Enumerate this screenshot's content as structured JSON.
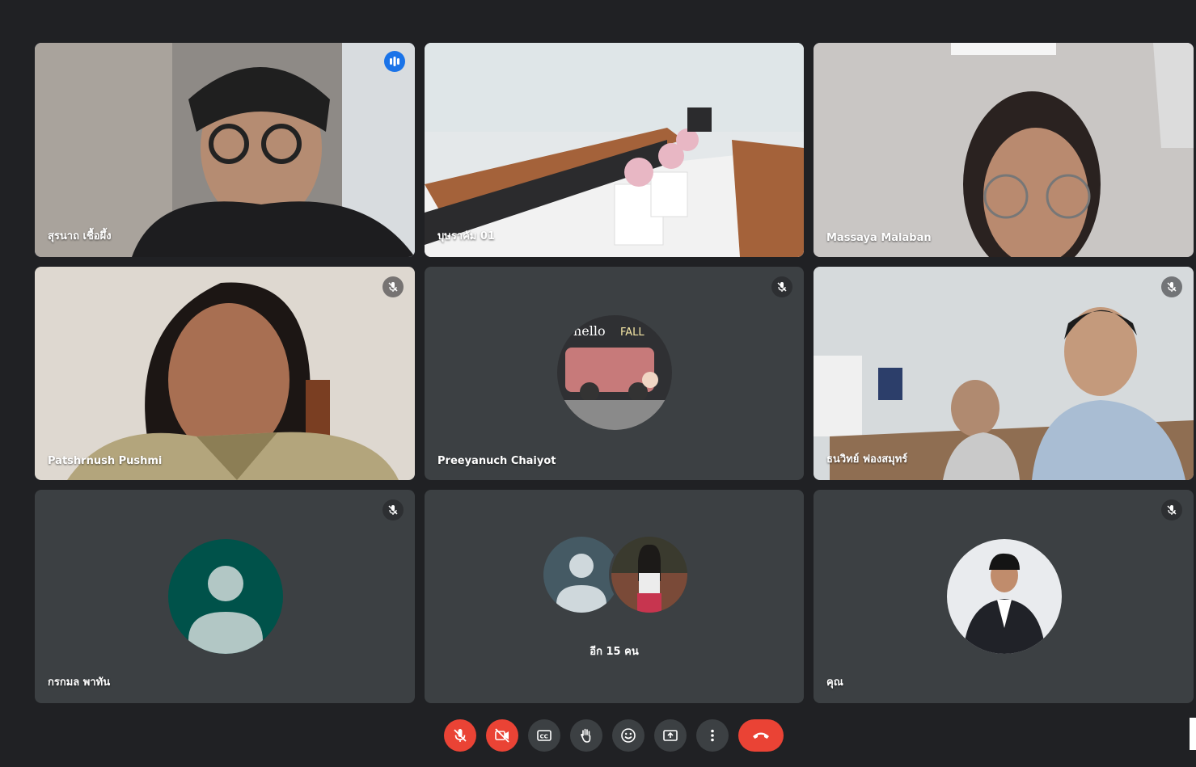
{
  "participants": [
    {
      "name": "สุรนาถ เชื้อผึ้ง"
    },
    {
      "name": "บุษราคัม 01"
    },
    {
      "name": "Massaya Malaban"
    },
    {
      "name": "Patshrnush Pushmi"
    },
    {
      "name": "Preeyanuch Chaiyot"
    },
    {
      "name": "ธนวิทย์ ฟองสมุทร์"
    },
    {
      "name": "กรกมล พาทัน"
    },
    {
      "name": "คุณ"
    }
  ],
  "overflow_tile": {
    "label": "อีก 15 คน"
  },
  "controls": {
    "mic": {
      "icon": "mic-off-icon",
      "state": "off"
    },
    "camera": {
      "icon": "camera-off-icon",
      "state": "off"
    },
    "captions": {
      "icon": "closed-captions-icon"
    },
    "raise_hand": {
      "icon": "raise-hand-icon"
    },
    "reactions": {
      "icon": "emoji-icon"
    },
    "present": {
      "icon": "present-screen-icon"
    },
    "more": {
      "icon": "more-options-icon"
    },
    "leave": {
      "icon": "end-call-icon"
    }
  },
  "colors": {
    "background": "#202124",
    "tile": "#3c4043",
    "danger": "#ea4335",
    "speaking": "#1a73e8",
    "active_border": "#8ab4f8",
    "avatar_green": "#00524a",
    "avatar_slate": "#455a64"
  }
}
